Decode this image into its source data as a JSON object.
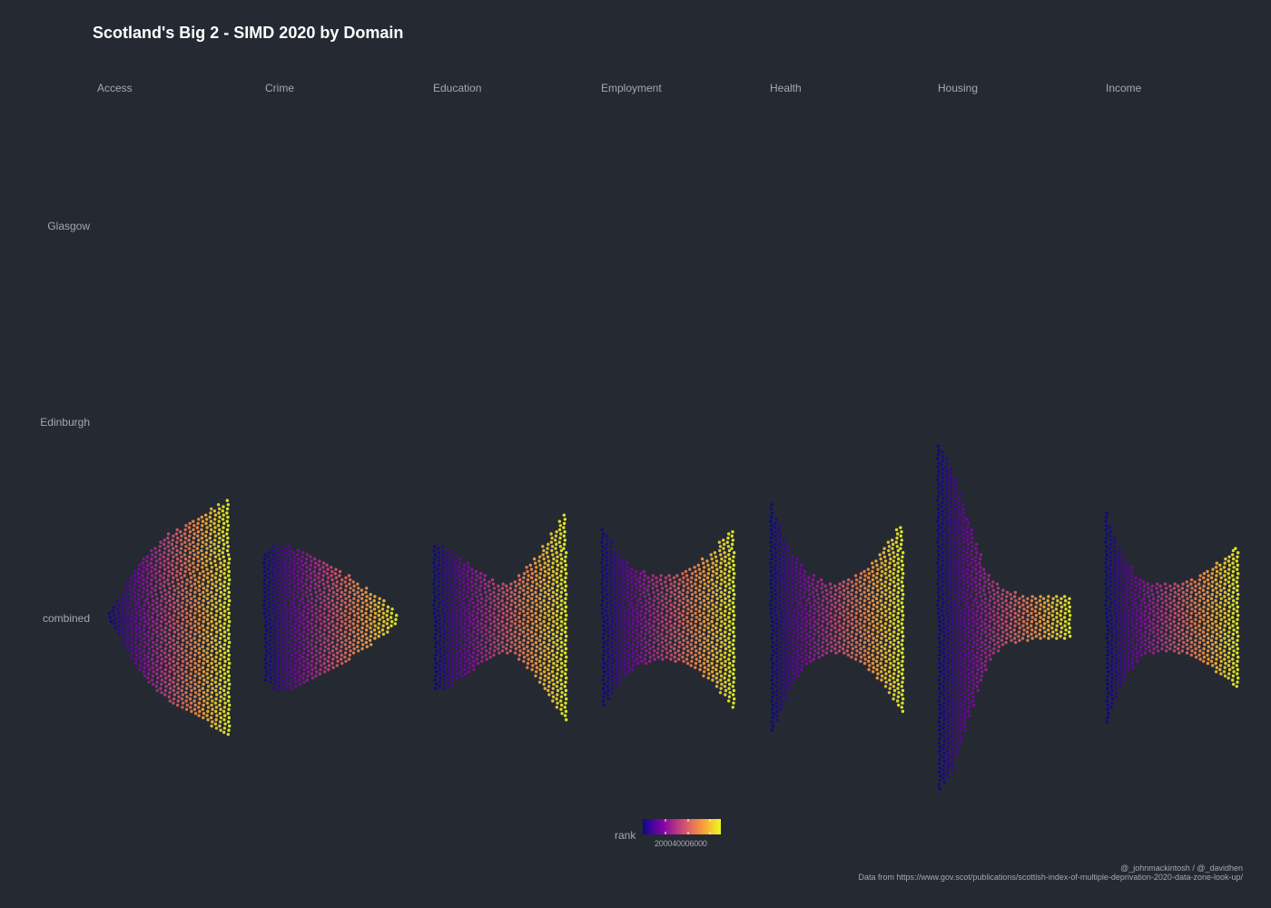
{
  "chart_data": {
    "type": "scatter",
    "title": "Scotland's Big 2 - SIMD 2020 by Domain",
    "facets": [
      "Access",
      "Crime",
      "Education",
      "Employment",
      "Health",
      "Housing",
      "Income"
    ],
    "rows": [
      "Glasgow",
      "Edinburgh",
      "combined"
    ],
    "x_variable": "rank",
    "x_range": [
      1,
      6976
    ],
    "color_scale": "plasma",
    "legend": {
      "title": "rank",
      "ticks": [
        "2000",
        "4000",
        "6000"
      ],
      "tick_values": [
        2000,
        4000,
        6000
      ],
      "position": "bottom"
    },
    "distribution_shape": [
      {
        "facet": "Access",
        "row": "combined",
        "half_width_profile": [
          8,
          25,
          45,
          62,
          75,
          85,
          92,
          98,
          105,
          112,
          118,
          125,
          130
        ]
      },
      {
        "facet": "Crime",
        "row": "combined",
        "half_width_profile": [
          70,
          82,
          80,
          76,
          72,
          66,
          60,
          52,
          44,
          36,
          28,
          20,
          8
        ]
      },
      {
        "facet": "Education",
        "row": "combined",
        "half_width_profile": [
          80,
          78,
          70,
          62,
          54,
          46,
          38,
          40,
          50,
          62,
          78,
          95,
          115
        ]
      },
      {
        "facet": "Employment",
        "row": "combined",
        "half_width_profile": [
          100,
          80,
          65,
          55,
          50,
          48,
          48,
          50,
          55,
          62,
          72,
          85,
          100
        ]
      },
      {
        "facet": "Health",
        "row": "combined",
        "half_width_profile": [
          125,
          95,
          72,
          55,
          45,
          40,
          40,
          43,
          50,
          60,
          72,
          88,
          105
        ]
      },
      {
        "facet": "Housing",
        "row": "combined",
        "half_width_profile": [
          190,
          175,
          140,
          100,
          65,
          42,
          32,
          28,
          26,
          25,
          25,
          25,
          24
        ]
      },
      {
        "facet": "Income",
        "row": "combined",
        "half_width_profile": [
          115,
          82,
          60,
          46,
          40,
          38,
          38,
          40,
          45,
          52,
          60,
          68,
          80
        ]
      }
    ]
  },
  "caption": {
    "line1": "@_johnmackintosh / @_davidhen",
    "line2": "Data from https://www.gov.scot/publications/scottish-index-of-multiple-deprivation-2020-data-zone-look-up/"
  }
}
